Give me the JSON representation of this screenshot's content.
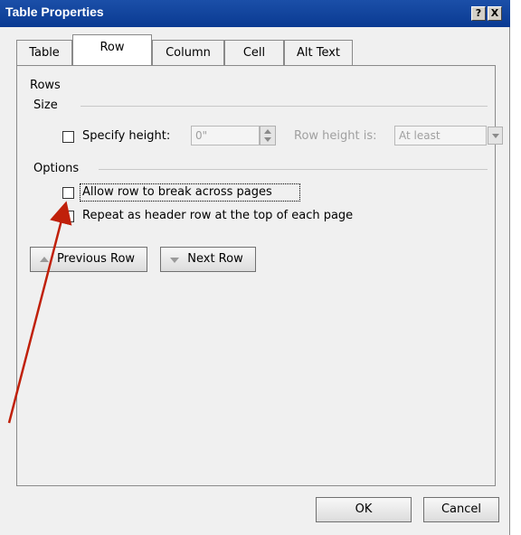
{
  "window": {
    "title": "Table Properties",
    "help_button": "?",
    "close_button": "X"
  },
  "tabs": [
    {
      "label": "Table",
      "active": false
    },
    {
      "label": "Row",
      "active": true
    },
    {
      "label": "Column",
      "active": false
    },
    {
      "label": "Cell",
      "active": false
    },
    {
      "label": "Alt Text",
      "active": false
    }
  ],
  "rows_section": {
    "heading": "Rows",
    "size_group": "Size",
    "specify_height": {
      "label": "Specify height:",
      "checked": false,
      "value": "0\""
    },
    "row_height_is": {
      "label": "Row height is:",
      "value": "At least"
    },
    "options_group": "Options",
    "allow_break": {
      "label": "Allow row to break across pages",
      "checked": false
    },
    "repeat_header": {
      "label": "Repeat as header row at the top of each page",
      "checked": false
    }
  },
  "nav": {
    "previous": "Previous Row",
    "next": "Next Row"
  },
  "footer": {
    "ok": "OK",
    "cancel": "Cancel"
  },
  "colors": {
    "title_bar": "#0a3a92",
    "annotation_arrow": "#c0200a"
  }
}
